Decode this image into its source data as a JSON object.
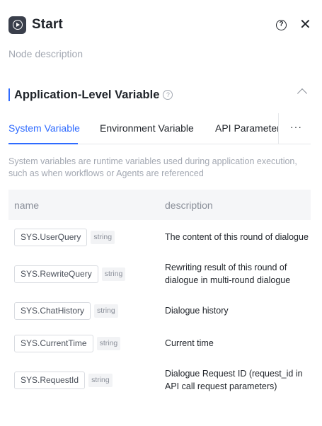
{
  "header": {
    "title": "Start",
    "help_icon": "question-circle-icon",
    "close_icon": "close-icon"
  },
  "node_description_placeholder": "Node description",
  "section": {
    "title": "Application-Level Variable"
  },
  "tabs": [
    {
      "label": "System Variable",
      "active": true
    },
    {
      "label": "Environment Variable",
      "active": false
    },
    {
      "label": "API Parameter",
      "active": false
    }
  ],
  "more_label": "···",
  "description": "System variables are runtime variables used during application execution, such as when workflows or Agents are referenced",
  "table": {
    "columns": {
      "name": "name",
      "description": "description"
    },
    "rows": [
      {
        "name": "SYS.UserQuery",
        "type": "string",
        "description": "The content of this round of dialogue"
      },
      {
        "name": "SYS.RewriteQuery",
        "type": "string",
        "description": "Rewriting result of this round of dialogue in multi-round dialogue"
      },
      {
        "name": "SYS.ChatHistory",
        "type": "string",
        "description": "Dialogue history"
      },
      {
        "name": "SYS.CurrentTime",
        "type": "string",
        "description": "Current time"
      },
      {
        "name": "SYS.RequestId",
        "type": "string",
        "description": "Dialogue Request ID (request_id in API call request parameters)"
      }
    ]
  },
  "colors": {
    "accent": "#2f6bff",
    "text": "#1f2329",
    "muted": "#a3a8b2",
    "header_bg": "#f5f6f8"
  }
}
